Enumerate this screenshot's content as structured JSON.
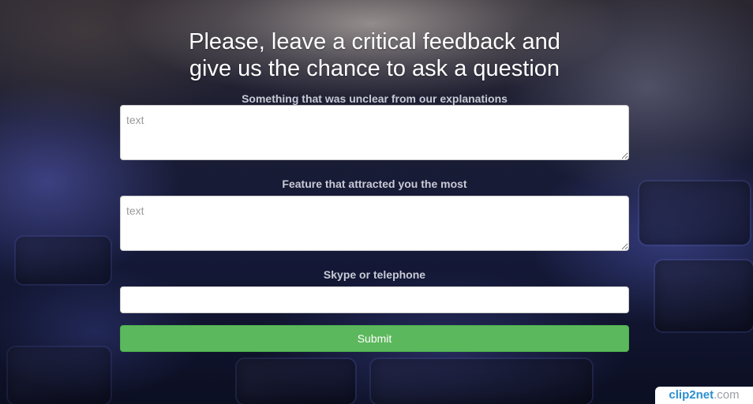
{
  "form": {
    "title_line1": "Please, leave a critical feedback and",
    "title_line2": "give us the chance to ask a question",
    "fields": [
      {
        "label": "Something that was unclear from our explanations",
        "placeholder": "text",
        "value": ""
      },
      {
        "label": "Feature that attracted you the most",
        "placeholder": "text",
        "value": ""
      },
      {
        "label": "Skype or telephone",
        "placeholder": "",
        "value": ""
      }
    ],
    "submit_label": "Submit"
  },
  "watermark": {
    "name": "clip2net",
    "tld": ".com"
  },
  "colors": {
    "submit_bg": "#5cb85c",
    "label_text": "#c9cad6",
    "title_text": "#ffffff",
    "watermark_text": "#2a8fd0"
  }
}
